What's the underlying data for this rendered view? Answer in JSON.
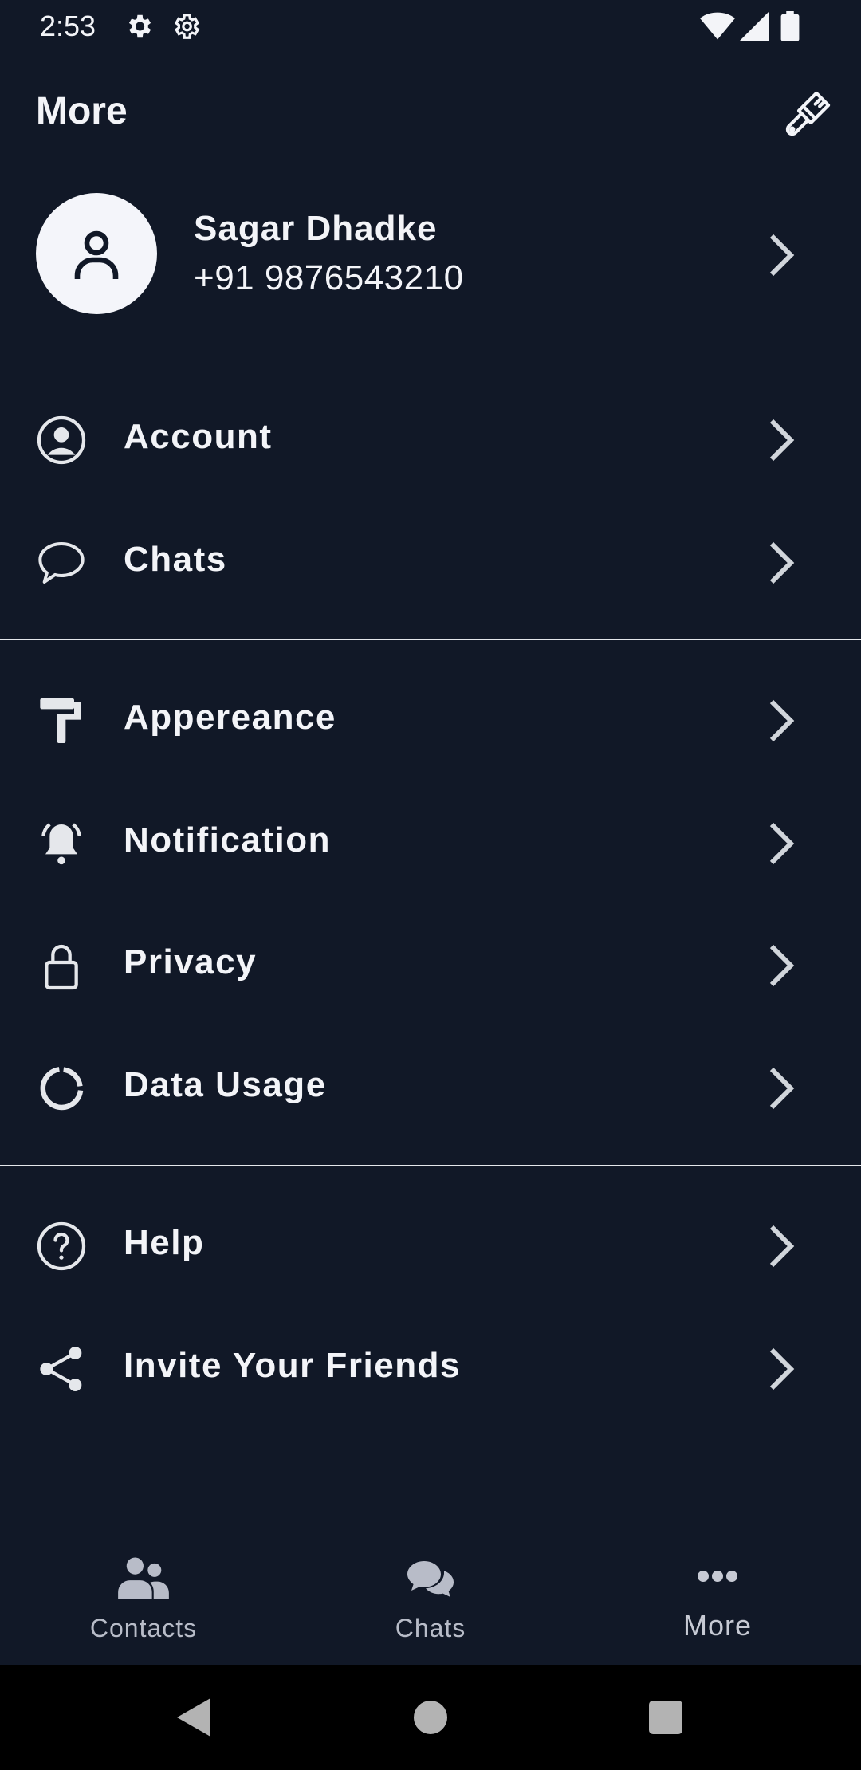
{
  "status_bar": {
    "time": "2:53"
  },
  "header": {
    "title": "More"
  },
  "profile": {
    "name": "Sagar Dhadke",
    "phone": "+91 9876543210"
  },
  "menu": {
    "group1": [
      {
        "label": "Account",
        "icon": "account-circle-icon"
      },
      {
        "label": "Chats",
        "icon": "chat-bubble-icon"
      }
    ],
    "group2": [
      {
        "label": "Appereance",
        "icon": "paint-roller-icon"
      },
      {
        "label": "Notification",
        "icon": "bell-icon"
      },
      {
        "label": "Privacy",
        "icon": "lock-icon"
      },
      {
        "label": "Data Usage",
        "icon": "data-usage-icon"
      }
    ],
    "group3": [
      {
        "label": "Help",
        "icon": "help-circle-icon"
      },
      {
        "label": "Invite Your Friends",
        "icon": "share-icon"
      }
    ]
  },
  "bottom_nav": {
    "tabs": [
      {
        "label": "Contacts",
        "icon": "contacts-icon"
      },
      {
        "label": "Chats",
        "icon": "chats-icon"
      },
      {
        "label": "More",
        "icon": "more-dots-icon",
        "active": true
      }
    ]
  },
  "colors": {
    "background": "#111827",
    "text": "#F3F4F8",
    "muted": "#B8BCC8",
    "divider": "#E5E7EB"
  }
}
